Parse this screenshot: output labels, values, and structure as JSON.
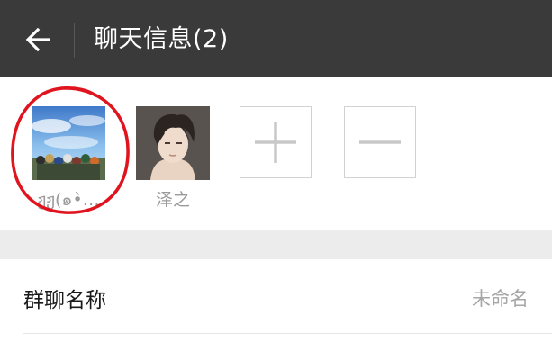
{
  "header": {
    "title": "聊天信息(2)",
    "back_icon": "arrow-left-icon",
    "background": "#3a3a3a"
  },
  "members": [
    {
      "name": "ჟჟ(๑•̀…",
      "avatar_icon": "anime-group-sky-avatar"
    },
    {
      "name": "泽之",
      "avatar_icon": "anime-boy-avatar"
    }
  ],
  "actions": {
    "add_icon": "plus-icon",
    "remove_icon": "minus-icon"
  },
  "settings": {
    "group_name_label": "群聊名称",
    "group_name_value": "未命名"
  },
  "annotation": {
    "color": "#e0141e"
  }
}
